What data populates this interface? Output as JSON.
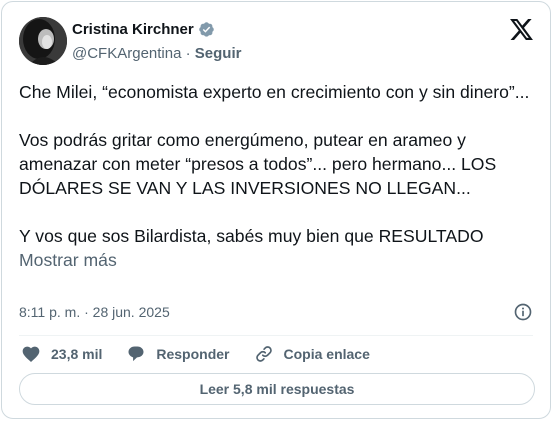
{
  "author": {
    "name": "Cristina Kirchner",
    "handle": "@CFKArgentina",
    "separator": "·",
    "follow_label": "Seguir",
    "avatar_icon": "profile-photo",
    "verified_icon": "verified-badge-icon"
  },
  "tweet": {
    "text": "Che Milei, “economista experto en crecimiento con y sin dinero”...\n\nVos podrás gritar como energúmeno, putear en arameo y amenazar con meter “presos a todos”... pero hermano... LOS DÓLARES SE VAN Y LAS INVERSIONES NO LLEGAN...\n\nY vos que sos Bilardista, sabés muy bien que RESULTADO ",
    "show_more": "Mostrar más"
  },
  "meta": {
    "timestamp": "8:11 p. m. · 28 jun. 2025"
  },
  "actions": {
    "likes_count": "23,8 mil",
    "reply_label": "Responder",
    "copy_link_label": "Copia enlace"
  },
  "replies_button": "Leer 5,8 mil respuestas",
  "colors": {
    "text": "#0f1419",
    "secondary": "#536471",
    "border": "#cfd9de",
    "verified": "#829aab"
  }
}
